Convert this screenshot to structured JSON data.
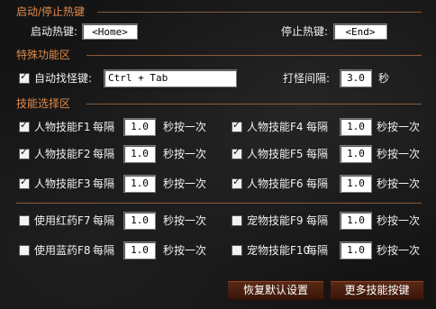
{
  "sections": {
    "hotkeys": "启动/停止热键",
    "special": "特殊功能区",
    "skills": "技能选择区"
  },
  "hotkeys": {
    "start_label": "启动热键:",
    "start_value": "<Home>",
    "stop_label": "停止热键:",
    "stop_value": "<End>"
  },
  "special": {
    "auto_target_label": "自动找怪键:",
    "auto_target_checked": true,
    "auto_target_value": "Ctrl + Tab",
    "interval_label": "打怪间隔:",
    "interval_value": "3.0",
    "interval_unit": "秒"
  },
  "common": {
    "every": "每隔",
    "press_once": "秒按一次"
  },
  "skills": [
    {
      "label": "人物技能F1",
      "checked": true,
      "value": "1.0"
    },
    {
      "label": "人物技能F4",
      "checked": true,
      "value": "1.0"
    },
    {
      "label": "人物技能F2",
      "checked": true,
      "value": "1.0"
    },
    {
      "label": "人物技能F5",
      "checked": true,
      "value": "1.0"
    },
    {
      "label": "人物技能F3",
      "checked": true,
      "value": "1.0"
    },
    {
      "label": "人物技能F6",
      "checked": true,
      "value": "1.0"
    },
    {
      "label": "使用红药F7",
      "checked": false,
      "value": "1.0"
    },
    {
      "label": "宠物技能F9",
      "checked": false,
      "value": "1.0"
    },
    {
      "label": "使用蓝药F8",
      "checked": false,
      "value": "1.0"
    },
    {
      "label": "宠物技能F10",
      "checked": false,
      "value": "1.0"
    }
  ],
  "buttons": {
    "restore_defaults": "恢复默认设置",
    "more_hotkeys": "更多技能按键"
  },
  "colors": {
    "section_title": "#e08a4a",
    "button_bg": "#4a2010",
    "background": "#141414"
  }
}
